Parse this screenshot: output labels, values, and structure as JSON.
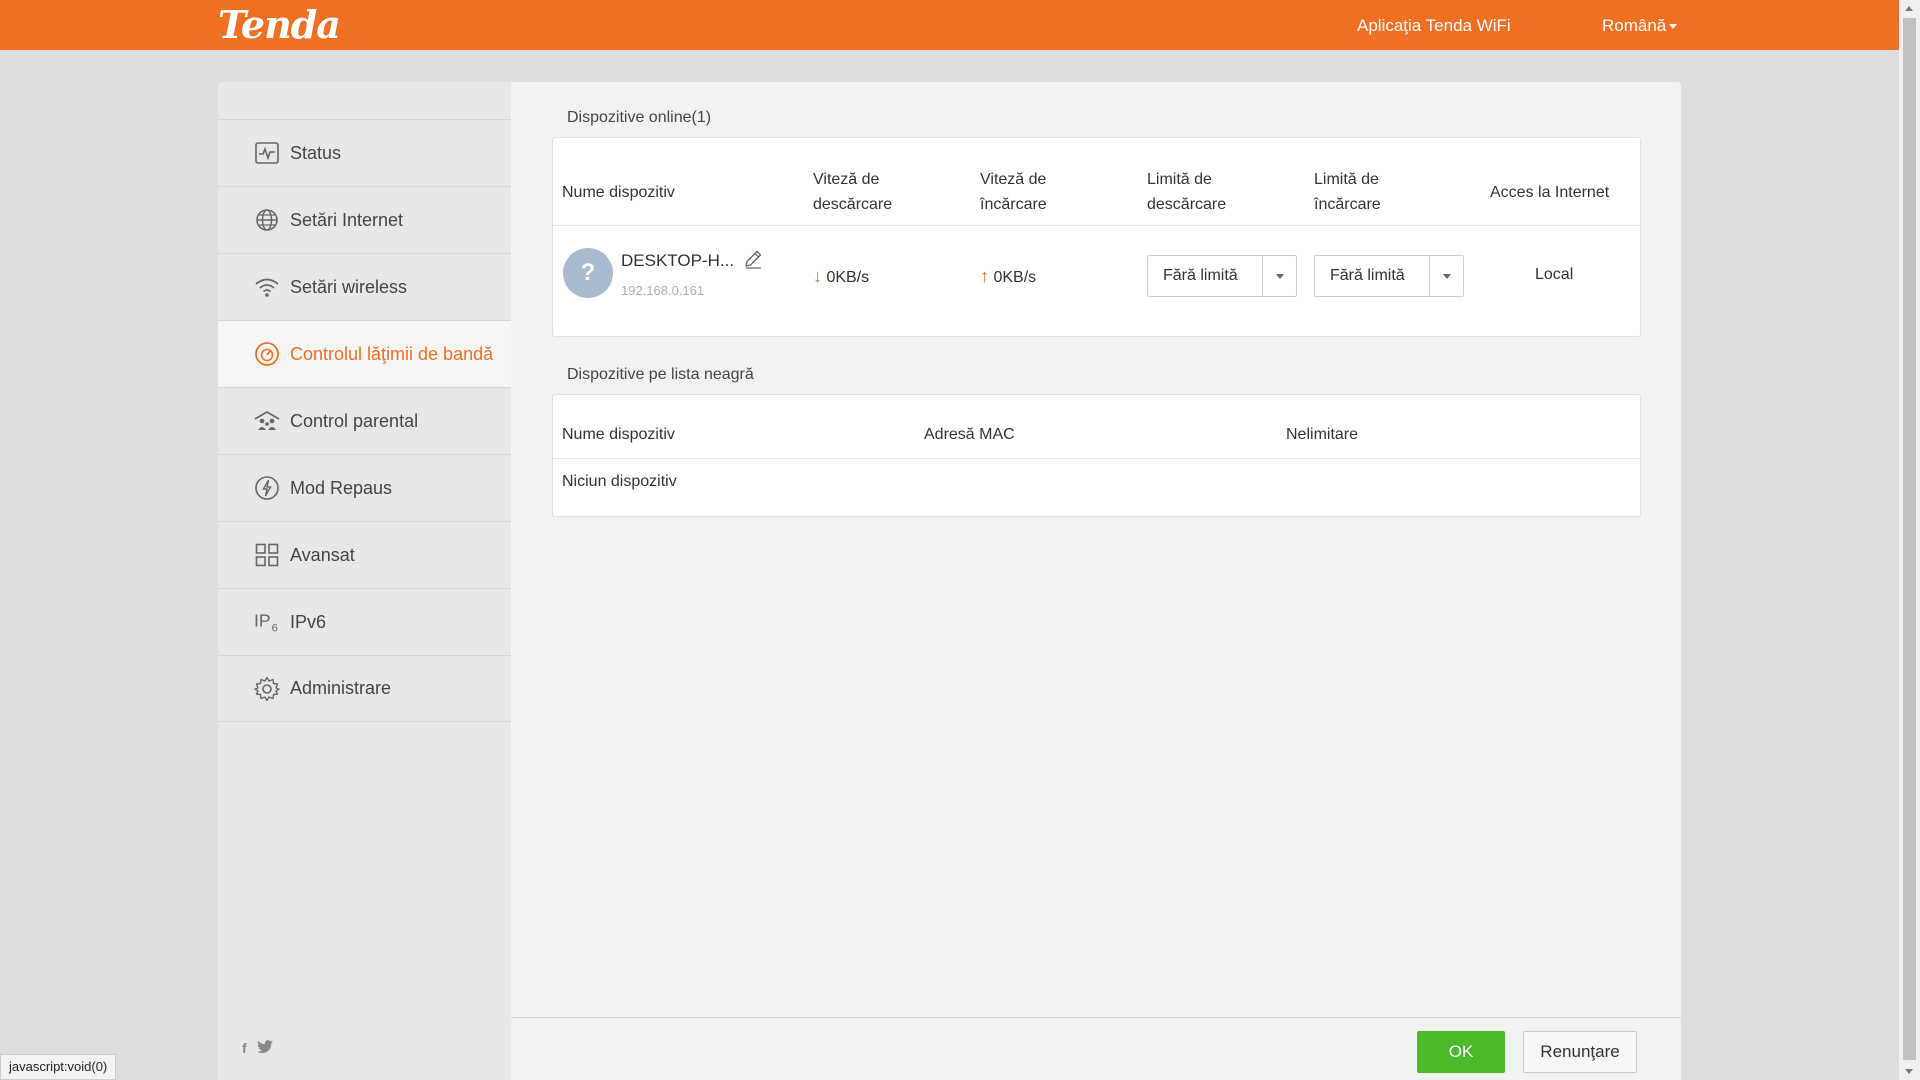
{
  "header": {
    "logo": "Tenda",
    "app_link": "Aplicaţia Tenda WiFi",
    "language": "Română",
    "bg_color": "#ef7023"
  },
  "sidebar": {
    "items": [
      {
        "label": "Status",
        "icon": "pulse-icon"
      },
      {
        "label": "Setări Internet",
        "icon": "globe-icon"
      },
      {
        "label": "Setări wireless",
        "icon": "wifi-icon"
      },
      {
        "label": "Controlul lăţimii de bandă",
        "icon": "speedometer-icon",
        "active": true
      },
      {
        "label": "Control parental",
        "icon": "family-icon"
      },
      {
        "label": "Mod Repaus",
        "icon": "power-icon"
      },
      {
        "label": "Avansat",
        "icon": "grid-icon"
      },
      {
        "label": "IPv6",
        "icon": "ipv6-icon"
      },
      {
        "label": "Administrare",
        "icon": "gear-icon"
      }
    ],
    "social": [
      "f",
      "twitter"
    ]
  },
  "online": {
    "title": "Dispozitive online(1)",
    "columns": {
      "name": "Nume dispozitiv",
      "down_speed": "Viteză de descărcare",
      "up_speed": "Viteză de încărcare",
      "down_limit": "Limită de descărcare",
      "up_limit": "Limită de încărcare",
      "access": "Acces la Internet"
    },
    "devices": [
      {
        "name": "DESKTOP-H...",
        "ip": "192.168.0.161",
        "avatar": "?",
        "down_speed": "0KB/s",
        "up_speed": "0KB/s",
        "down_limit": "Fără limită",
        "up_limit": "Fără limită",
        "access": "Local"
      }
    ]
  },
  "blacklist": {
    "title": "Dispozitive pe lista neagră",
    "columns": {
      "name": "Nume dispozitiv",
      "mac": "Adresă MAC",
      "unlimit": "Nelimitare"
    },
    "empty": "Niciun dispozitiv"
  },
  "footer": {
    "ok": "OK",
    "cancel": "Renunţare"
  },
  "statusbar": "javascript:void(0)",
  "colors": {
    "accent": "#ef7023",
    "ok_green": "#4cba29",
    "down_arrow": "#4cba29",
    "up_arrow": "#ef7023"
  }
}
